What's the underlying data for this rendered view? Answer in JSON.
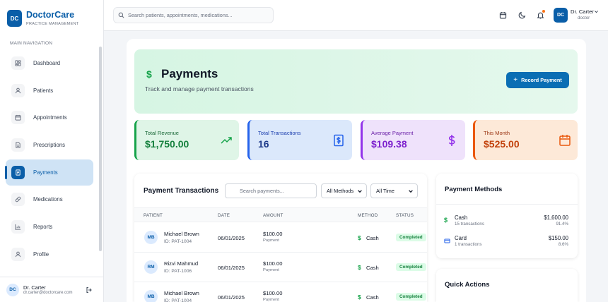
{
  "brand": {
    "badge": "DC",
    "name": "DoctorCare",
    "tagline": "PRACTICE MANAGEMENT"
  },
  "sidebar": {
    "section_label": "MAIN NAVIGATION",
    "items": [
      {
        "label": "Dashboard",
        "icon": "dashboard-icon"
      },
      {
        "label": "Patients",
        "icon": "user-icon"
      },
      {
        "label": "Appointments",
        "icon": "calendar-icon"
      },
      {
        "label": "Prescriptions",
        "icon": "document-icon"
      },
      {
        "label": "Payments",
        "icon": "receipt-icon",
        "active": true
      },
      {
        "label": "Medications",
        "icon": "pill-icon"
      },
      {
        "label": "Reports",
        "icon": "chart-icon"
      },
      {
        "label": "Profile",
        "icon": "user-icon"
      }
    ],
    "user": {
      "initials": "DC",
      "name": "Dr. Carter",
      "email": "dr.carter@doctorcare.com"
    }
  },
  "topbar": {
    "search_placeholder": "Search patients, appointments, medications...",
    "user_initials": "DC",
    "user_name": "Dr. Carter",
    "user_role": "doctor"
  },
  "hero": {
    "icon": "$",
    "title": "Payments",
    "subtitle": "Track and manage payment transactions",
    "record_label": "Record Payment"
  },
  "stats": [
    {
      "label": "Total Revenue",
      "value": "$1,750.00"
    },
    {
      "label": "Total Transactions",
      "value": "16"
    },
    {
      "label": "Average Payment",
      "value": "$109.38"
    },
    {
      "label": "This Month",
      "value": "$525.00"
    }
  ],
  "transactions": {
    "title": "Payment Transactions",
    "search_placeholder": "Search payments...",
    "method_filter": "All Methods",
    "time_filter": "All Time",
    "columns": [
      "PATIENT",
      "DATE",
      "AMOUNT",
      "METHOD",
      "STATUS"
    ],
    "rows": [
      {
        "initials": "MB",
        "name": "Michael Brown",
        "id": "ID: PAT-1004",
        "date": "06/01/2025",
        "amount": "$100.00",
        "amount_label": "Payment",
        "method": "Cash",
        "status": "Completed"
      },
      {
        "initials": "RM",
        "name": "Rizvi Mahmud",
        "id": "ID: PAT-1006",
        "date": "06/01/2025",
        "amount": "$100.00",
        "amount_label": "Payment",
        "method": "Cash",
        "status": "Completed"
      },
      {
        "initials": "MB",
        "name": "Michael Brown",
        "id": "ID: PAT-1004",
        "date": "06/01/2025",
        "amount": "$100.00",
        "amount_label": "Payment",
        "method": "Cash",
        "status": "Completed"
      }
    ]
  },
  "payment_methods": {
    "title": "Payment Methods",
    "items": [
      {
        "name": "Cash",
        "count": "15 transactions",
        "amount": "$1,600.00",
        "percent": "91.4%"
      },
      {
        "name": "Card",
        "count": "1 transactions",
        "amount": "$150.00",
        "percent": "8.6%"
      }
    ]
  },
  "quick_actions": {
    "title": "Quick Actions"
  },
  "colors": {
    "primary": "#0a5ea8",
    "success": "#16a34a",
    "info": "#2563eb",
    "purple": "#9333ea",
    "orange": "#ea580c"
  }
}
